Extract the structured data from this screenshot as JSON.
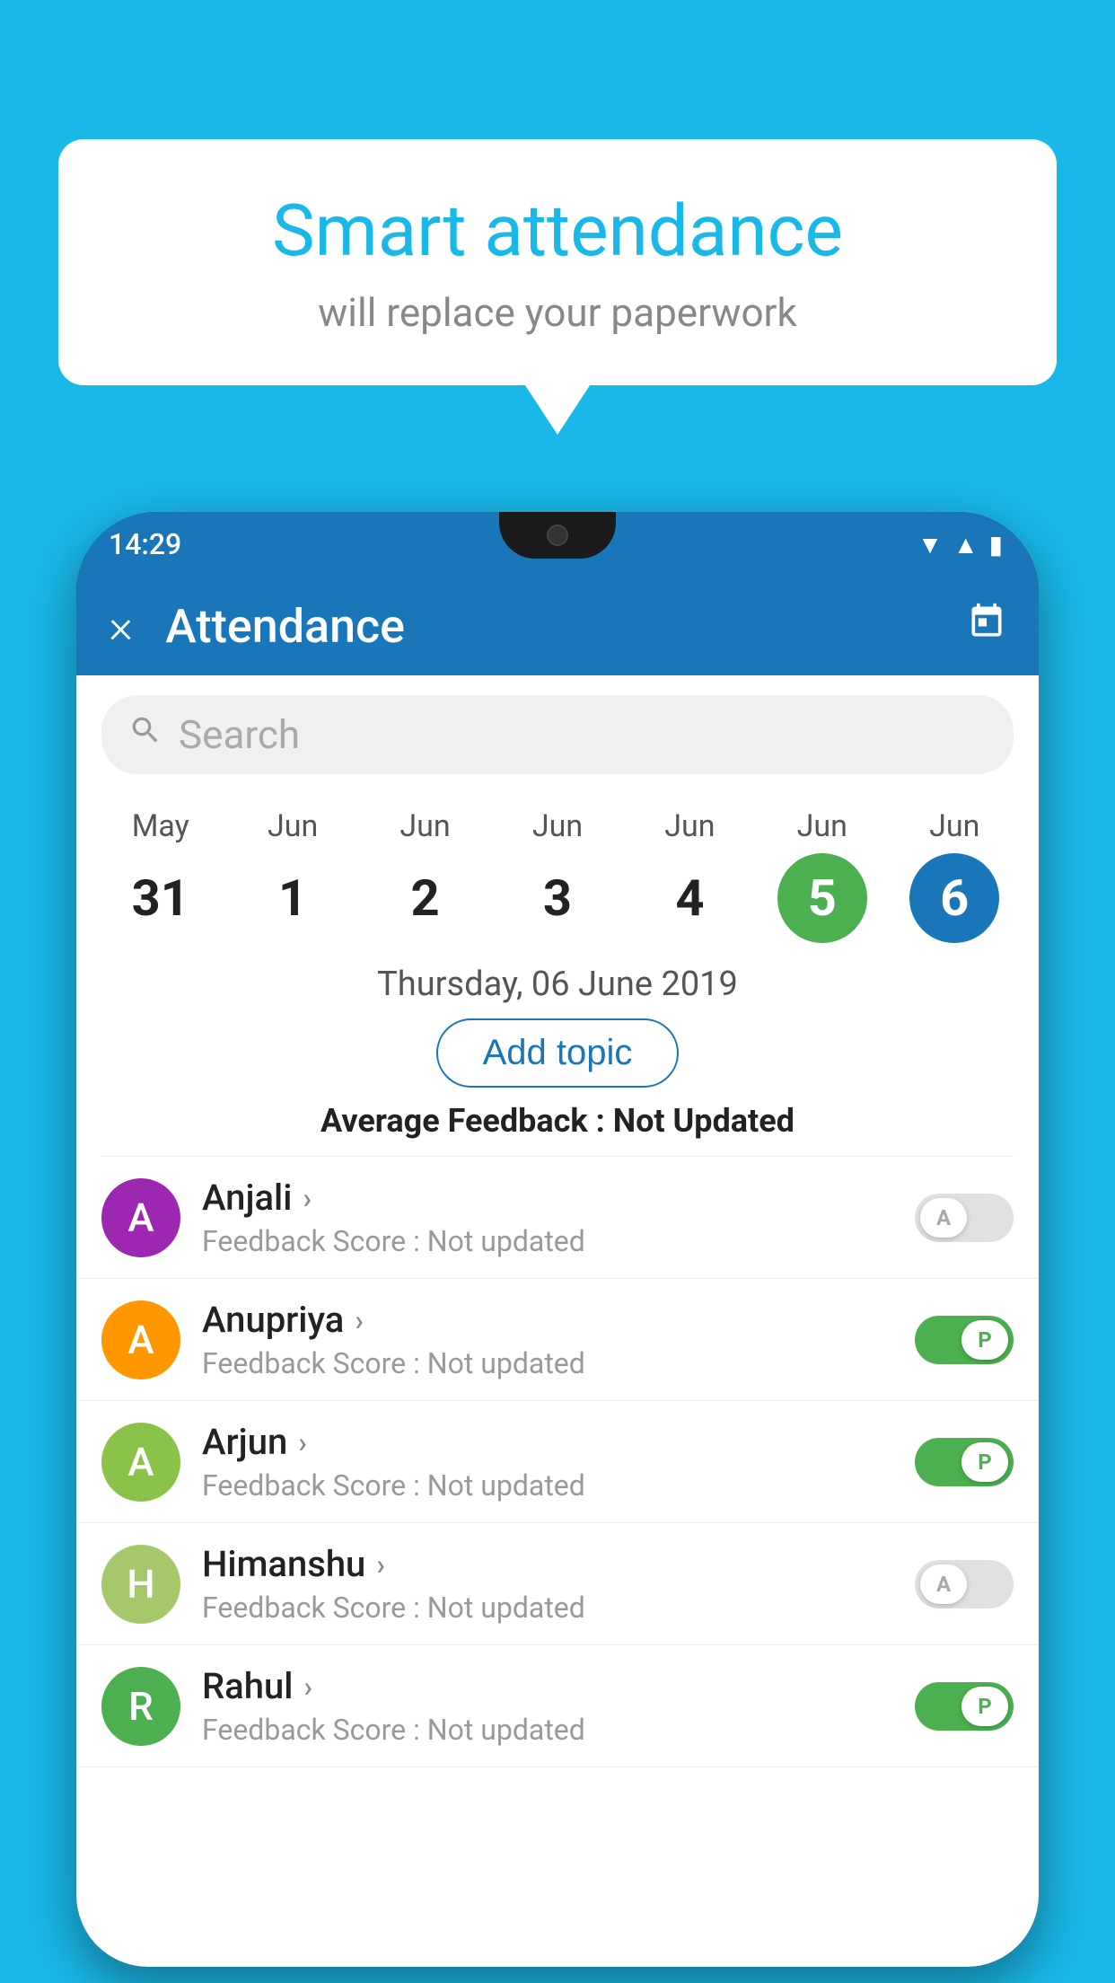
{
  "app": {
    "background_color": "#1ab8e8"
  },
  "speech_bubble": {
    "title": "Smart attendance",
    "subtitle": "will replace your paperwork"
  },
  "status_bar": {
    "time": "14:29",
    "wifi_icon": "▼",
    "signal_icon": "▲",
    "battery_icon": "▮"
  },
  "app_bar": {
    "close_label": "×",
    "title": "Attendance",
    "calendar_icon": "📅"
  },
  "search": {
    "placeholder": "Search"
  },
  "calendar": {
    "days": [
      {
        "month": "May",
        "date": "31",
        "style": "normal"
      },
      {
        "month": "Jun",
        "date": "1",
        "style": "normal"
      },
      {
        "month": "Jun",
        "date": "2",
        "style": "normal"
      },
      {
        "month": "Jun",
        "date": "3",
        "style": "normal"
      },
      {
        "month": "Jun",
        "date": "4",
        "style": "normal"
      },
      {
        "month": "Jun",
        "date": "5",
        "style": "today"
      },
      {
        "month": "Jun",
        "date": "6",
        "style": "selected"
      }
    ]
  },
  "selected_date": "Thursday, 06 June 2019",
  "add_topic_label": "Add topic",
  "average_feedback": {
    "label": "Average Feedback : ",
    "value": "Not Updated"
  },
  "students": [
    {
      "name": "Anjali",
      "avatar_letter": "A",
      "avatar_color": "#9c27b0",
      "feedback_label": "Feedback Score : ",
      "feedback_value": "Not updated",
      "attendance": "absent"
    },
    {
      "name": "Anupriya",
      "avatar_letter": "A",
      "avatar_color": "#ff9800",
      "feedback_label": "Feedback Score : ",
      "feedback_value": "Not updated",
      "attendance": "present"
    },
    {
      "name": "Arjun",
      "avatar_letter": "A",
      "avatar_color": "#8bc34a",
      "feedback_label": "Feedback Score : ",
      "feedback_value": "Not updated",
      "attendance": "present"
    },
    {
      "name": "Himanshu",
      "avatar_letter": "H",
      "avatar_color": "#a5c96a",
      "feedback_label": "Feedback Score : ",
      "feedback_value": "Not updated",
      "attendance": "absent"
    },
    {
      "name": "Rahul",
      "avatar_letter": "R",
      "avatar_color": "#4caf50",
      "feedback_label": "Feedback Score : ",
      "feedback_value": "Not updated",
      "attendance": "present"
    }
  ],
  "toggle": {
    "present_label": "P",
    "absent_label": "A"
  }
}
